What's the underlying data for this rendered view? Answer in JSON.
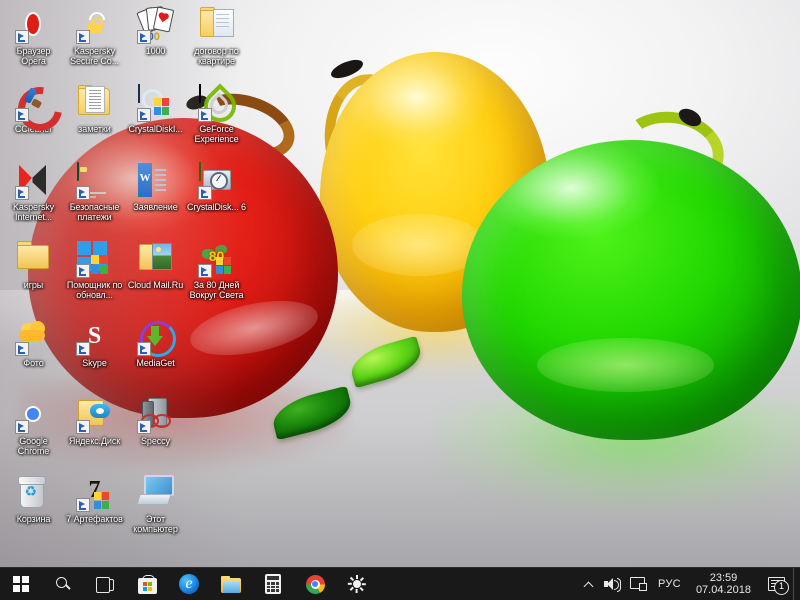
{
  "desktop": {
    "wallpaper_description": "three translucent glass apples (red, yellow, green) with two glass leaves on a light gray surface",
    "colors": {
      "apple_red": "#e01d16",
      "apple_yellow": "#ffcf10",
      "apple_green": "#21d800",
      "background": "#e9e9ea",
      "taskbar": "#191919",
      "label_text": "#ffffff"
    },
    "icons": [
      {
        "label": "Браузер Opera",
        "art": "opera",
        "shortcut": true
      },
      {
        "label": "Kaspersky Secure Co...",
        "art": "hexlock",
        "shortcut": true
      },
      {
        "label": "1000",
        "art": "cards",
        "shortcut": true
      },
      {
        "label": "договор по квартире",
        "art": "folder-doc",
        "shortcut": false
      },
      {
        "label": "CCleaner",
        "art": "ccleaner",
        "shortcut": true
      },
      {
        "label": "заметки",
        "art": "folder-notes",
        "shortcut": false
      },
      {
        "label": "CrystalDiskI...",
        "art": "cdi",
        "shortcut": true
      },
      {
        "label": "GeForce Experience",
        "art": "geforce",
        "shortcut": true
      },
      {
        "label": "Kaspersky Internet...",
        "art": "kav",
        "shortcut": true
      },
      {
        "label": "Безопасные платежи",
        "art": "card-pay",
        "shortcut": true
      },
      {
        "label": "Заявление",
        "art": "word",
        "shortcut": false
      },
      {
        "label": "CrystalDisk... 6",
        "art": "cdm",
        "shortcut": true
      },
      {
        "label": "игры",
        "art": "folder",
        "shortcut": false
      },
      {
        "label": "Помощник по обновл...",
        "art": "win4",
        "shortcut": true
      },
      {
        "label": "Cloud Mail.Ru",
        "art": "folder-pic",
        "shortcut": false
      },
      {
        "label": "За 80 Дней Вокруг Света",
        "art": "globe80",
        "shortcut": true
      },
      {
        "label": "Фото",
        "art": "photos",
        "shortcut": true
      },
      {
        "label": "Skype",
        "art": "skype",
        "shortcut": true
      },
      {
        "label": "MediaGet",
        "art": "mediaget",
        "shortcut": true
      },
      {
        "label": "",
        "art": "none",
        "shortcut": false
      },
      {
        "label": "Google Chrome",
        "art": "chrome",
        "shortcut": true
      },
      {
        "label": "Яндекс.Диск",
        "art": "yadisk",
        "shortcut": true
      },
      {
        "label": "Speccy",
        "art": "speccy",
        "shortcut": true
      },
      {
        "label": "",
        "art": "none",
        "shortcut": false
      },
      {
        "label": "Корзина",
        "art": "bin",
        "shortcut": false
      },
      {
        "label": "7 Артефактов",
        "art": "artifacts",
        "shortcut": true
      },
      {
        "label": "Этот компьютер",
        "art": "pc",
        "shortcut": false
      },
      {
        "label": "",
        "art": "none",
        "shortcut": false
      }
    ]
  },
  "taskbar": {
    "buttons": [
      {
        "name": "start-button",
        "icon": "windows-start-icon"
      },
      {
        "name": "search-button",
        "icon": "search-icon"
      },
      {
        "name": "task-view-button",
        "icon": "task-view-icon"
      },
      {
        "name": "microsoft-store-button",
        "icon": "store-icon"
      },
      {
        "name": "edge-button",
        "icon": "edge-icon"
      },
      {
        "name": "file-explorer-button",
        "icon": "folder-icon"
      },
      {
        "name": "calculator-button",
        "icon": "calculator-icon"
      },
      {
        "name": "chrome-button",
        "icon": "chrome-icon"
      },
      {
        "name": "brightness-button",
        "icon": "brightness-icon"
      }
    ],
    "tray": {
      "chevron": "show-hidden-icons",
      "volume": "speaker-icon",
      "network": "network-icon",
      "language": "РУС",
      "time": "23:59",
      "date": "07.04.2018",
      "action_center_badge": "1"
    }
  }
}
